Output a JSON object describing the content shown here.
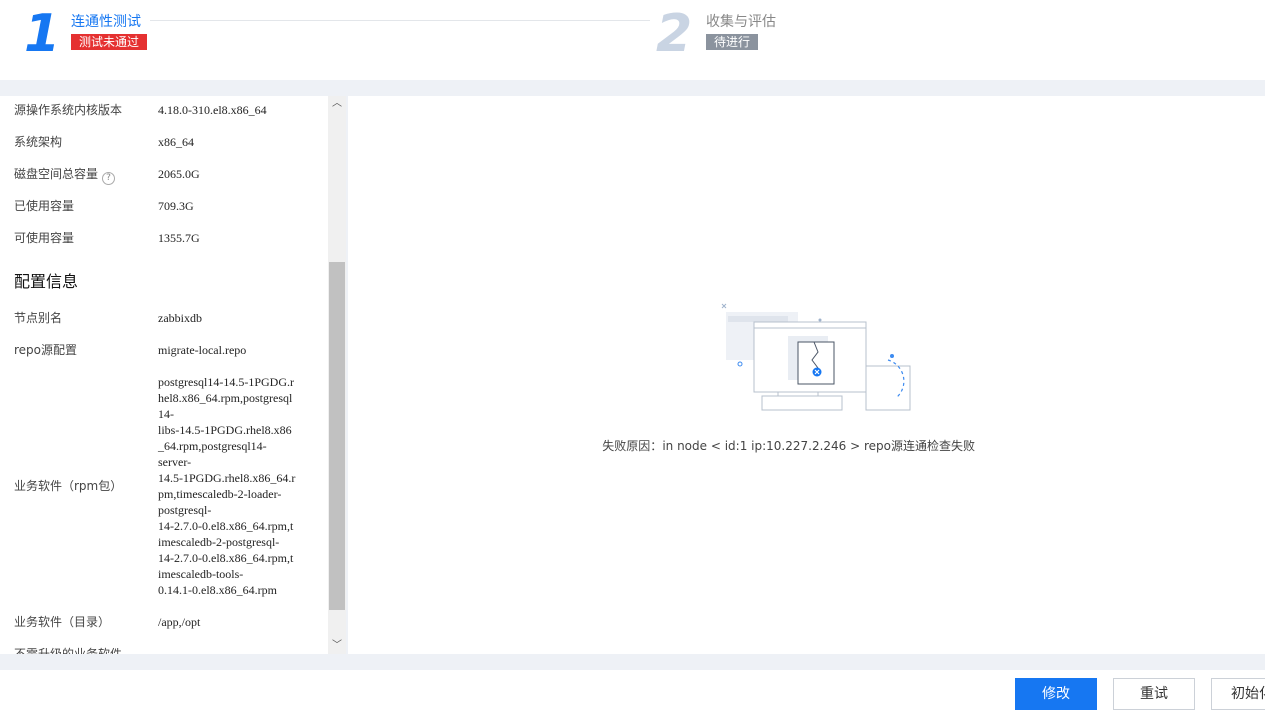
{
  "steps": [
    {
      "number": "1",
      "title": "连通性测试",
      "badge": "测试未通过"
    },
    {
      "number": "2",
      "title": "收集与评估",
      "badge": "待进行"
    }
  ],
  "info_rows_top": [
    {
      "key": "源操作系统内核版本",
      "value": "4.18.0-310.el8.x86_64"
    },
    {
      "key": "系统架构",
      "value": "x86_64"
    },
    {
      "key": "磁盘空间总容量",
      "value": "2065.0G"
    },
    {
      "key": "已使用容量",
      "value": "709.3G"
    },
    {
      "key": "可使用容量",
      "value": "1355.7G"
    }
  ],
  "help_icon_glyph": "?",
  "config_section": {
    "title": "配置信息",
    "rows": [
      {
        "key": "节点别名",
        "value": "zabbixdb"
      },
      {
        "key": "repo源配置",
        "value": "migrate-local.repo"
      },
      {
        "key": "业务软件（rpm包）",
        "value": "postgresql14-14.5-1PGDG.rhel8.x86_64.rpm,postgresql14-libs-14.5-1PGDG.rhel8.x86_64.rpm,postgresql14-server-14.5-1PGDG.rhel8.x86_64.rpm,timescaledb-2-loader-postgresql-14-2.7.0-0.el8.x86_64.rpm,timescaledb-2-postgresql-14-2.7.0-0.el8.x86_64.rpm,timescaledb-tools-0.14.1-0.el8.x86_64.rpm"
      },
      {
        "key": "业务软件（目录）",
        "value": "/app,/opt"
      },
      {
        "key": "不需升级的业务软件",
        "value": ""
      }
    ]
  },
  "rpm_lines": [
    "postgresql14-14.5-1PGDG.r",
    "hel8.x86_64.rpm,postgresql",
    "14-",
    "libs-14.5-1PGDG.rhel8.x86",
    "_64.rpm,postgresql14-",
    "server-",
    "14.5-1PGDG.rhel8.x86_64.r",
    "pm,timescaledb-2-loader-",
    "postgresql-",
    "14-2.7.0-0.el8.x86_64.rpm,t",
    "imescaledb-2-postgresql-",
    "14-2.7.0-0.el8.x86_64.rpm,t",
    "imescaledb-tools-",
    "0.14.1-0.el8.x86_64.rpm"
  ],
  "scroll": {
    "up_glyph": "︿",
    "down_glyph": "﹀"
  },
  "failure": {
    "label": "失败原因：",
    "message": "in node < id:1 ip:10.227.2.246 > repo源连通检查失败"
  },
  "buttons": {
    "modify": "修改",
    "retry": "重试",
    "initialize": "初始化"
  },
  "colors": {
    "primary": "#1677f2",
    "danger": "#e53131",
    "pending": "#8b939e"
  }
}
